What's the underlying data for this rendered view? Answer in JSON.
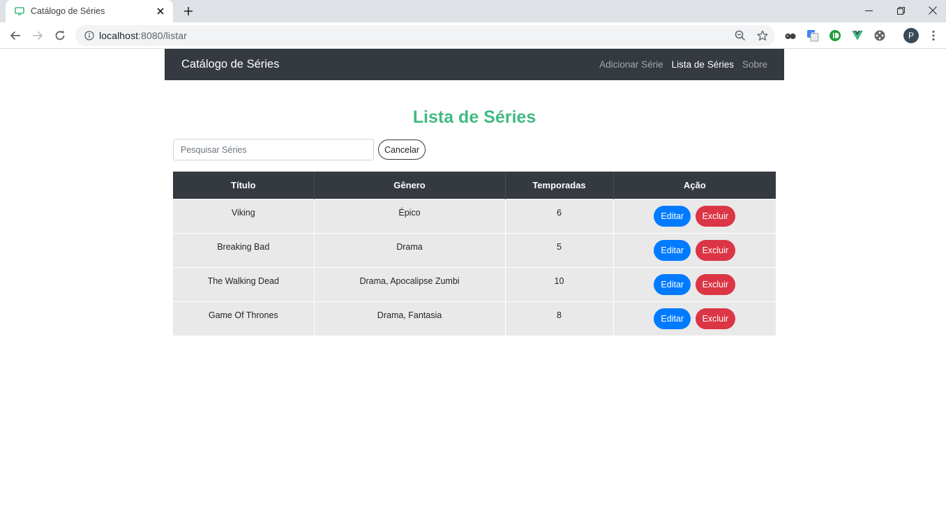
{
  "browser": {
    "tab_title": "Catálogo de Séries",
    "url_host": "localhost",
    "url_rest": ":8080/listar",
    "profile_initial": "P"
  },
  "navbar": {
    "brand": "Catálogo de Séries",
    "links": [
      {
        "label": "Adicionar Série",
        "active": false
      },
      {
        "label": "Lista de Séries",
        "active": true
      },
      {
        "label": "Sobre",
        "active": false
      }
    ]
  },
  "page": {
    "title": "Lista de Séries",
    "search_placeholder": "Pesquisar Séries",
    "search_value": "",
    "cancel_label": "Cancelar"
  },
  "table": {
    "headers": [
      "Título",
      "Gênero",
      "Temporadas",
      "Ação"
    ],
    "rows": [
      {
        "titulo": "Viking",
        "genero": "Épico",
        "temporadas": "6"
      },
      {
        "titulo": "Breaking Bad",
        "genero": "Drama",
        "temporadas": "5"
      },
      {
        "titulo": "The Walking Dead",
        "genero": "Drama, Apocalipse Zumbi",
        "temporadas": "10"
      },
      {
        "titulo": "Game Of Thrones",
        "genero": "Drama, Fantasia",
        "temporadas": "8"
      }
    ],
    "edit_label": "Editar",
    "delete_label": "Excluir"
  },
  "colors": {
    "accent": "#42b983",
    "navbar_bg": "#343a40",
    "edit_button": "#007bff",
    "delete_button": "#dc3545"
  }
}
